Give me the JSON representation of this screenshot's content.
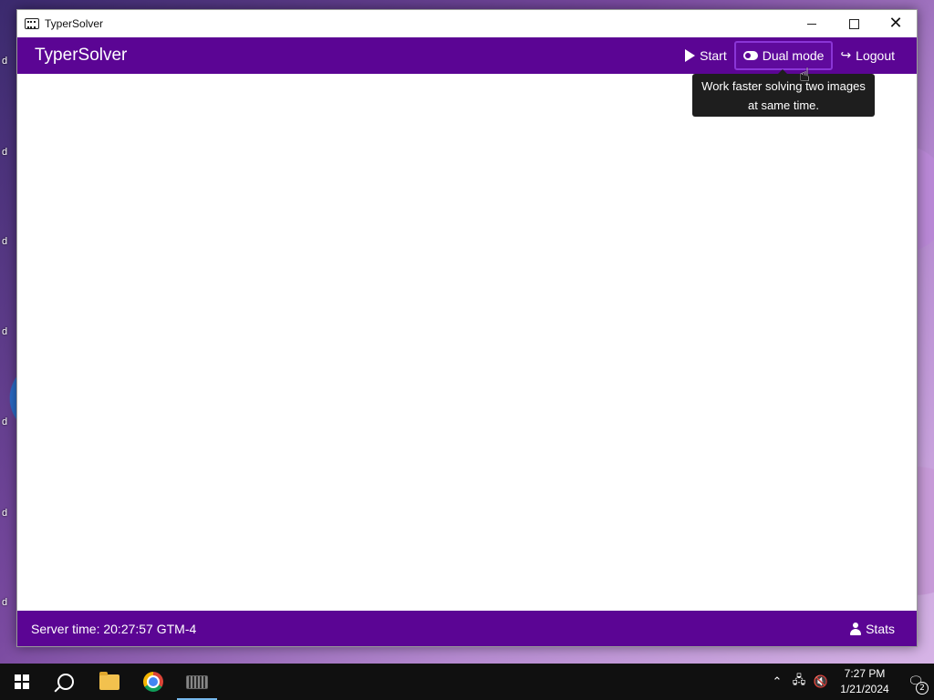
{
  "window": {
    "title": "TyperSolver"
  },
  "header": {
    "brand": "TyperSolver",
    "nav": {
      "start": "Start",
      "dual_mode": "Dual mode",
      "logout": "Logout"
    }
  },
  "tooltip": {
    "text": "Work faster solving two images at same time."
  },
  "footer": {
    "server_time": "Server time: 20:27:57 GTM-4",
    "stats": "Stats"
  },
  "taskbar": {
    "time": "7:27 PM",
    "date": "1/21/2024",
    "notifications": "2"
  },
  "colors": {
    "brand_purple": "#5b0594",
    "tooltip_bg": "#1e1e1e",
    "taskbar_bg": "#101010"
  }
}
